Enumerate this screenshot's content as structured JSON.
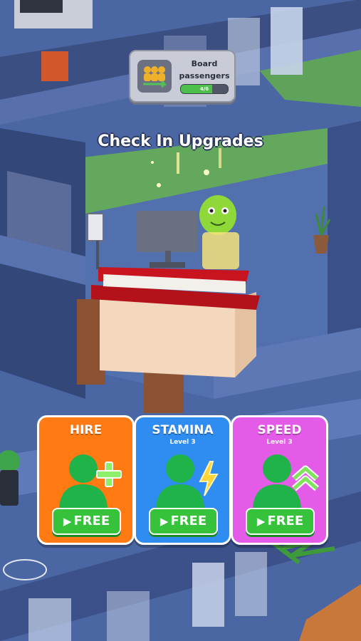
{
  "quest": {
    "title": "Board passengers",
    "progress_text": "4/6",
    "progress": 0.66
  },
  "banner": {
    "text": "Check In Upgrades"
  },
  "cards": [
    {
      "title": "HIRE",
      "subtitle": "",
      "button": "FREE",
      "color": "#ff7a12",
      "icon": "plus-icon"
    },
    {
      "title": "STAMINA",
      "subtitle": "Level 3",
      "button": "FREE",
      "color": "#2f8cf0",
      "icon": "lightning-icon"
    },
    {
      "title": "SPEED",
      "subtitle": "Level 3",
      "button": "FREE",
      "color": "#e45be8",
      "icon": "double-chevron-up-icon"
    }
  ]
}
